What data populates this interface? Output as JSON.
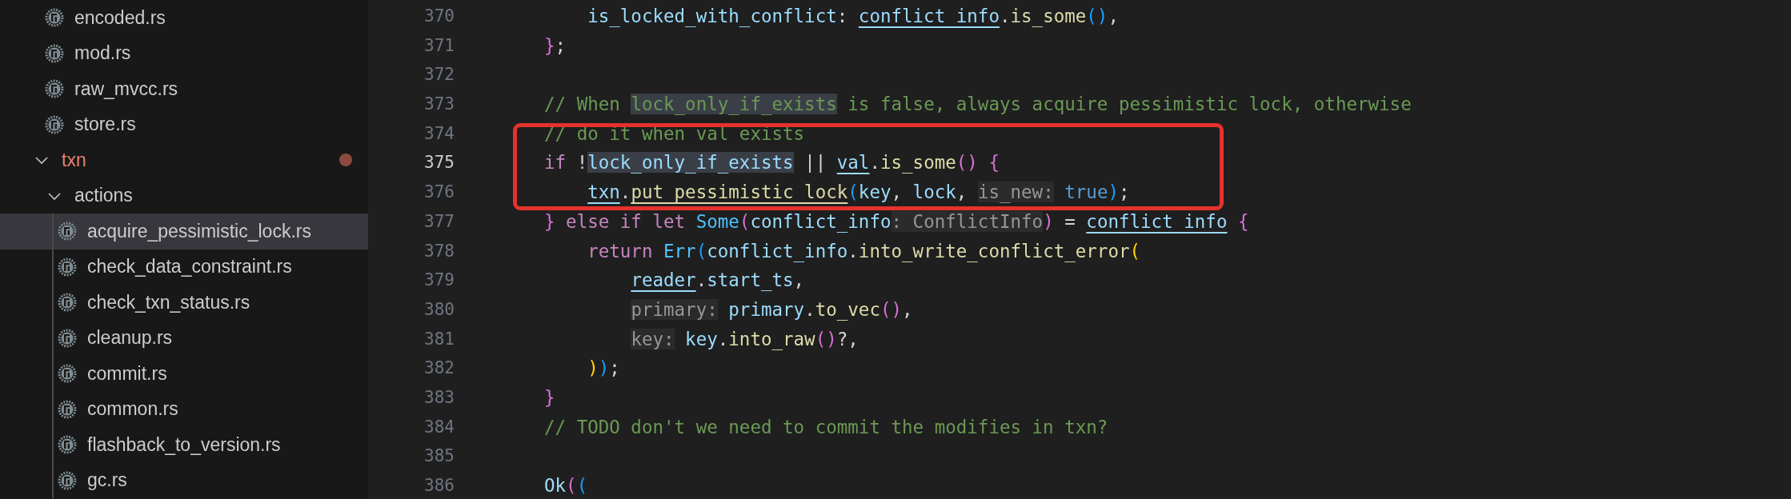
{
  "sidebar": {
    "tree": [
      {
        "kind": "cut_off_folder",
        "children": [
          {
            "kind": "file",
            "name": "encoded.rs",
            "selected": false,
            "modified": false
          },
          {
            "kind": "file",
            "name": "mod.rs",
            "selected": false,
            "modified": false
          },
          {
            "kind": "file",
            "name": "raw_mvcc.rs",
            "selected": false,
            "modified": false
          },
          {
            "kind": "file",
            "name": "store.rs",
            "selected": false,
            "modified": false
          }
        ]
      },
      {
        "kind": "folder",
        "name": "txn",
        "expanded": true,
        "selected": false,
        "modified": true,
        "children": [
          {
            "kind": "folder",
            "name": "actions",
            "expanded": true,
            "selected": false,
            "modified": false,
            "children": [
              {
                "kind": "file",
                "name": "acquire_pessimistic_lock.rs",
                "selected": true,
                "modified": false
              },
              {
                "kind": "file",
                "name": "check_data_constraint.rs",
                "selected": false,
                "modified": false
              },
              {
                "kind": "file",
                "name": "check_txn_status.rs",
                "selected": false,
                "modified": false
              },
              {
                "kind": "file",
                "name": "cleanup.rs",
                "selected": false,
                "modified": false
              },
              {
                "kind": "file",
                "name": "commit.rs",
                "selected": false,
                "modified": false
              },
              {
                "kind": "file",
                "name": "common.rs",
                "selected": false,
                "modified": false
              },
              {
                "kind": "file",
                "name": "flashback_to_version.rs",
                "selected": false,
                "modified": false
              },
              {
                "kind": "file",
                "name": "gc.rs",
                "selected": false,
                "modified": false
              }
            ]
          }
        ]
      }
    ]
  },
  "editor": {
    "annotation": {
      "kind": "rectangle"
    },
    "lines": [
      {
        "number": "370",
        "current": false,
        "tokens": [
          {
            "t": "    is_locked_with_conflict",
            "kind": "var"
          },
          {
            "t": ": ",
            "kind": "plain"
          },
          {
            "t": "conflict_info",
            "kind": "var_ref"
          },
          {
            "t": ".",
            "kind": "plain"
          },
          {
            "t": "is_some",
            "kind": "fn"
          },
          {
            "t": "()",
            "kind": "blue"
          },
          {
            "t": ",",
            "kind": "plain"
          }
        ]
      },
      {
        "number": "371",
        "current": false,
        "tokens": [
          {
            "t": "}",
            "kind": "pink"
          },
          {
            "t": ";",
            "kind": "plain"
          }
        ]
      },
      {
        "number": "372",
        "current": false
      },
      {
        "number": "373",
        "current": false,
        "tokens": [
          {
            "t": "// When ",
            "kind": "comment"
          },
          {
            "t": "lock_only_if_exists",
            "kind": "comment_match"
          },
          {
            "t": " is false, always acquire pessimistic lock, otherwise",
            "kind": "comment"
          }
        ]
      },
      {
        "number": "374",
        "current": false,
        "tokens": [
          {
            "t": "// do it when val exists",
            "kind": "comment"
          }
        ]
      },
      {
        "number": "375",
        "current": true,
        "tokens": [
          {
            "t": "if",
            "kind": "keyword"
          },
          {
            "t": " !",
            "kind": "plain"
          },
          {
            "t": "lock_only_if_exists",
            "kind": "var_match"
          },
          {
            "t": " || ",
            "kind": "plain"
          },
          {
            "t": "val",
            "kind": "var_ref"
          },
          {
            "t": ".",
            "kind": "plain"
          },
          {
            "t": "is_some",
            "kind": "fn"
          },
          {
            "t": "()",
            "kind": "pink"
          },
          {
            "t": " {",
            "kind": "pink"
          }
        ]
      },
      {
        "number": "376",
        "current": false,
        "tokens": [
          {
            "t": "    txn",
            "kind": "var_ref"
          },
          {
            "t": ".",
            "kind": "plain"
          },
          {
            "t": "put_pessimistic_lock",
            "kind": "fn_ref"
          },
          {
            "t": "(",
            "kind": "blue"
          },
          {
            "t": "key",
            "kind": "var"
          },
          {
            "t": ", ",
            "kind": "plain"
          },
          {
            "t": "lock",
            "kind": "var"
          },
          {
            "t": ", ",
            "kind": "plain"
          },
          {
            "t": "is_new:",
            "kind": "hint"
          },
          {
            "t": " true",
            "kind": "bool"
          },
          {
            "t": ")",
            "kind": "blue"
          },
          {
            "t": ";",
            "kind": "plain"
          }
        ]
      },
      {
        "number": "377",
        "current": false,
        "tokens": [
          {
            "t": "}",
            "kind": "pink"
          },
          {
            "t": " else if let",
            "kind": "keyword"
          },
          {
            "t": " Some",
            "kind": "type"
          },
          {
            "t": "(",
            "kind": "pink"
          },
          {
            "t": "conflict_info",
            "kind": "var"
          },
          {
            "t": ": ConflictInfo",
            "kind": "hint"
          },
          {
            "t": ")",
            "kind": "pink"
          },
          {
            "t": " = ",
            "kind": "plain"
          },
          {
            "t": "conflict_info",
            "kind": "var_ref"
          },
          {
            "t": " {",
            "kind": "pink"
          }
        ]
      },
      {
        "number": "378",
        "current": false,
        "tokens": [
          {
            "t": "    return",
            "kind": "keyword"
          },
          {
            "t": " Err",
            "kind": "type"
          },
          {
            "t": "(",
            "kind": "blue"
          },
          {
            "t": "conflict_info",
            "kind": "var"
          },
          {
            "t": ".",
            "kind": "plain"
          },
          {
            "t": "into_write_conflict_error",
            "kind": "fn"
          },
          {
            "t": "(",
            "kind": "yellow"
          }
        ]
      },
      {
        "number": "379",
        "current": false,
        "tokens": [
          {
            "t": "        reader",
            "kind": "var_ref"
          },
          {
            "t": ".",
            "kind": "plain"
          },
          {
            "t": "start_ts",
            "kind": "var"
          },
          {
            "t": ",",
            "kind": "plain"
          }
        ]
      },
      {
        "number": "380",
        "current": false,
        "tokens": [
          {
            "t": "        primary:",
            "kind": "hint"
          },
          {
            "t": " primary",
            "kind": "var"
          },
          {
            "t": ".",
            "kind": "plain"
          },
          {
            "t": "to_vec",
            "kind": "fn"
          },
          {
            "t": "()",
            "kind": "pink"
          },
          {
            "t": ",",
            "kind": "plain"
          }
        ]
      },
      {
        "number": "381",
        "current": false,
        "tokens": [
          {
            "t": "        key:",
            "kind": "hint"
          },
          {
            "t": " key",
            "kind": "var"
          },
          {
            "t": ".",
            "kind": "plain"
          },
          {
            "t": "into_raw",
            "kind": "fn"
          },
          {
            "t": "()",
            "kind": "pink"
          },
          {
            "t": "?,",
            "kind": "plain"
          }
        ]
      },
      {
        "number": "382",
        "current": false,
        "tokens": [
          {
            "t": "    )",
            "kind": "yellow"
          },
          {
            "t": ")",
            "kind": "blue"
          },
          {
            "t": ";",
            "kind": "plain"
          }
        ]
      },
      {
        "number": "383",
        "current": false,
        "tokens": [
          {
            "t": "}",
            "kind": "pink"
          }
        ]
      },
      {
        "number": "384",
        "current": false,
        "tokens": [
          {
            "t": "// TODO don't we need to commit the modifies in txn?",
            "kind": "comment"
          }
        ]
      },
      {
        "number": "385",
        "current": false
      },
      {
        "number": "386",
        "current": false,
        "tokens": [
          {
            "t": "Ok",
            "kind": "var"
          },
          {
            "t": "(",
            "kind": "pink"
          },
          {
            "t": "(",
            "kind": "blue"
          }
        ]
      }
    ]
  }
}
